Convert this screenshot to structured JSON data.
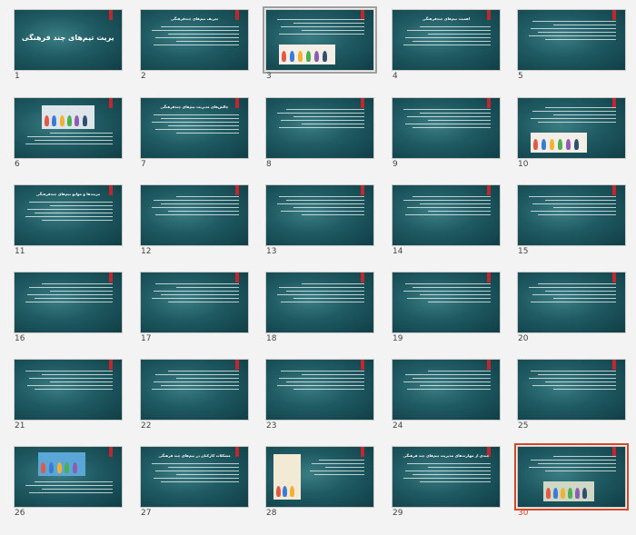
{
  "panel": "slide-sorter",
  "accent_color": "#c0282d",
  "selected_color": "#d24726",
  "selected_slide": "30",
  "slides": [
    {
      "number": "1",
      "title": "مدیریت تیم‌های چند فرهنگی",
      "layout": "title",
      "picture": ""
    },
    {
      "number": "2",
      "title": "تعریف تیم‌های چندفرهنگی",
      "layout": "text",
      "picture": ""
    },
    {
      "number": "3",
      "title": "",
      "layout": "text-picture-bottom",
      "picture": "people-icon"
    },
    {
      "number": "4",
      "title": "اهمیت تیم‌های چندفرهنگی",
      "layout": "text",
      "picture": ""
    },
    {
      "number": "5",
      "title": "",
      "layout": "text",
      "picture": ""
    },
    {
      "number": "6",
      "title": "",
      "layout": "picture-top",
      "picture": "office-icon"
    },
    {
      "number": "7",
      "title": "چالش‌های مدیریت تیم‌های چندفرهنگی",
      "layout": "text",
      "picture": ""
    },
    {
      "number": "8",
      "title": "",
      "layout": "text",
      "picture": ""
    },
    {
      "number": "9",
      "title": "",
      "layout": "text",
      "picture": ""
    },
    {
      "number": "10",
      "title": "",
      "layout": "text-picture-bottom",
      "picture": "team-icon"
    },
    {
      "number": "11",
      "title": "مزیت‌ها و موانع تیم‌های چندفرهنگی",
      "layout": "text",
      "picture": ""
    },
    {
      "number": "12",
      "title": "",
      "layout": "text",
      "picture": ""
    },
    {
      "number": "13",
      "title": "",
      "layout": "text",
      "picture": ""
    },
    {
      "number": "14",
      "title": "",
      "layout": "text",
      "picture": ""
    },
    {
      "number": "15",
      "title": "",
      "layout": "text",
      "picture": ""
    },
    {
      "number": "16",
      "title": "",
      "layout": "text",
      "picture": ""
    },
    {
      "number": "17",
      "title": "",
      "layout": "text",
      "picture": ""
    },
    {
      "number": "18",
      "title": "",
      "layout": "text",
      "picture": ""
    },
    {
      "number": "19",
      "title": "",
      "layout": "text",
      "picture": ""
    },
    {
      "number": "20",
      "title": "",
      "layout": "text",
      "picture": ""
    },
    {
      "number": "21",
      "title": "",
      "layout": "text",
      "picture": ""
    },
    {
      "number": "22",
      "title": "",
      "layout": "text",
      "picture": ""
    },
    {
      "number": "23",
      "title": "",
      "layout": "text",
      "picture": ""
    },
    {
      "number": "24",
      "title": "",
      "layout": "text",
      "picture": ""
    },
    {
      "number": "25",
      "title": "",
      "layout": "text",
      "picture": ""
    },
    {
      "number": "26",
      "title": "",
      "layout": "picture-top",
      "picture": "rowing-icon"
    },
    {
      "number": "27",
      "title": "مشکلات کارکنان در تیم‌های چند فرهنگی",
      "layout": "text",
      "picture": ""
    },
    {
      "number": "28",
      "title": "",
      "layout": "picture-left",
      "picture": "crowd-icon"
    },
    {
      "number": "29",
      "title": "چندی از مهارت‌های مدیریت تیم‌های چند فرهنگی",
      "layout": "text",
      "picture": ""
    },
    {
      "number": "30",
      "title": "",
      "layout": "text-picture-bottom",
      "picture": "handshake-icon"
    }
  ]
}
